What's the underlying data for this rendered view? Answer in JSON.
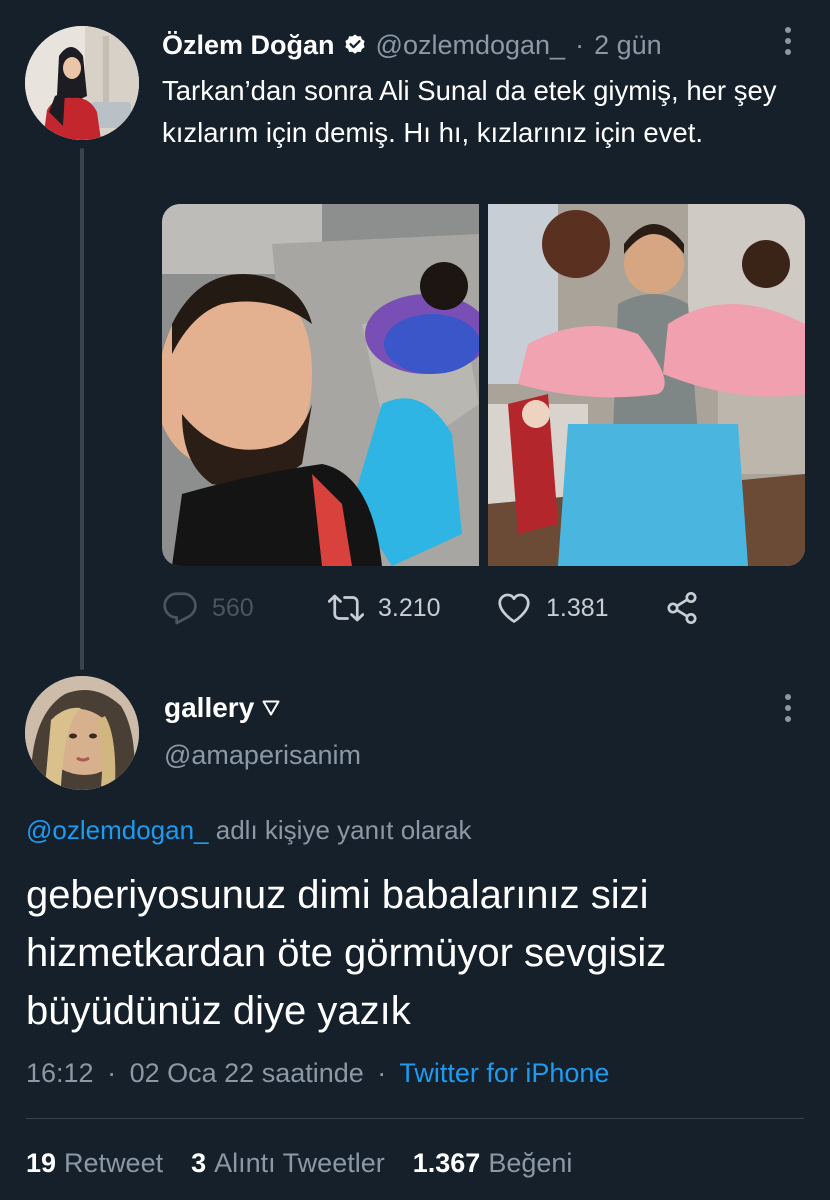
{
  "tweet": {
    "author_name": "Özlem Doğan",
    "author_handle": "@ozlemdogan_",
    "separator": "·",
    "time_ago": "2 gün",
    "text": "Tarkan’dan sonra Ali Sunal da etek giymiş, her şey kızlarım için demiş. Hı hı, kızlarınız için evet.",
    "actions": {
      "replies": "560",
      "retweets": "3.210",
      "likes": "1.381"
    }
  },
  "reply": {
    "author_name": "gallery",
    "author_handle": "@amaperisanim",
    "reply_to_handle": "@ozlemdogan_",
    "reply_to_suffix": "adlı kişiye yanıt olarak",
    "text": "geberiyosunuz dimi babalarınız sizi hizmetkardan öte görmüyor sevgisiz büyüdünüz diye yazık",
    "time": "16:12",
    "date": "02 Oca 22 saatinde",
    "separator": "·",
    "source": "Twitter for iPhone",
    "stats": {
      "retweets_count": "19",
      "retweets_label": "Retweet",
      "quotes_count": "3",
      "quotes_label": "Alıntı Tweetler",
      "likes_count": "1.367",
      "likes_label": "Beğeni"
    }
  },
  "colors": {
    "background": "#15202b",
    "text": "#ffffff",
    "muted": "#8b98a5",
    "link": "#1d9bf0",
    "divider": "#38444d"
  },
  "icons": [
    "verified-badge-icon",
    "more-options-icon",
    "reply-icon",
    "retweet-icon",
    "like-icon",
    "share-icon",
    "triangle-icon"
  ]
}
